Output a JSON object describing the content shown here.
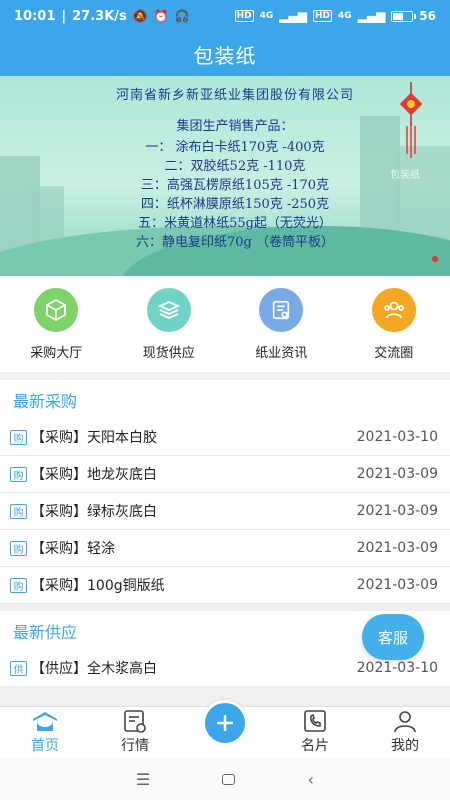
{
  "status_bar": {
    "time": "10:01",
    "speed": "27.3K/s",
    "hd1": "HD",
    "net1": "4G",
    "hd2": "HD",
    "net2": "4G",
    "battery": "56"
  },
  "header": {
    "title": "包装纸"
  },
  "banner": {
    "company": "河南省新乡新亚纸业集团股份有限公司",
    "intro": "集团生产销售产品：",
    "lines": [
      "一：   涂布白卡纸170克 -400克",
      "二：双胶纸52克 -110克",
      "三：高强瓦楞原纸105克 -170克",
      "四：纸杯淋膜原纸150克 -250克",
      "五：米黄道林纸55g起（无荧光）",
      "六：静电复印纸70g （卷筒平板）"
    ],
    "watermark": "包装纸"
  },
  "quick_nav": [
    {
      "label": "采购大厅",
      "icon": "cube-icon",
      "color": "#7ed26a"
    },
    {
      "label": "现货供应",
      "icon": "stack-icon",
      "color": "#6fd4c6"
    },
    {
      "label": "纸业资讯",
      "icon": "news-icon",
      "color": "#7aa9e8"
    },
    {
      "label": "交流圈",
      "icon": "group-icon",
      "color": "#f5a623"
    }
  ],
  "latest_purchase": {
    "title": "最新采购",
    "tag": "购",
    "items": [
      {
        "title": "【采购】天阳本白胶",
        "date": "2021-03-10"
      },
      {
        "title": "【采购】地龙灰底白",
        "date": "2021-03-09"
      },
      {
        "title": "【采购】绿标灰底白",
        "date": "2021-03-09"
      },
      {
        "title": "【采购】轻涂",
        "date": "2021-03-09"
      },
      {
        "title": "【采购】100g铜版纸",
        "date": "2021-03-09"
      }
    ]
  },
  "latest_supply": {
    "title": "最新供应",
    "tag": "供",
    "items": [
      {
        "title": "【供应】全木浆高白",
        "date": "2021-03-10"
      }
    ]
  },
  "fab": {
    "label": "客服"
  },
  "tabbar": [
    {
      "label": "首页",
      "icon": "home-icon"
    },
    {
      "label": "行情",
      "icon": "market-icon"
    },
    {
      "label": "名片",
      "icon": "card-icon"
    },
    {
      "label": "我的",
      "icon": "profile-icon"
    }
  ],
  "colors": {
    "primary": "#3ba6e9"
  }
}
